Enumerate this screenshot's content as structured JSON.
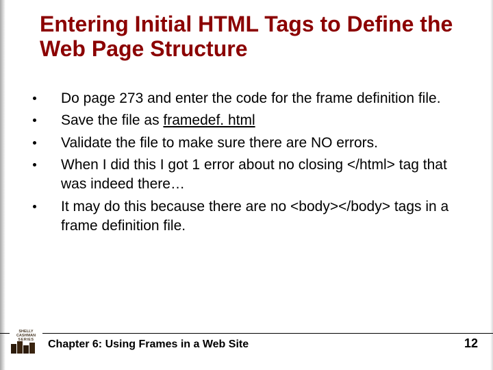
{
  "title": "Entering Initial HTML Tags to Define the Web Page Structure",
  "bullets": [
    {
      "pre": "Do page 273 and enter the code for the frame definition file.",
      "u": "",
      "post": ""
    },
    {
      "pre": "Save the file as ",
      "u": "framedef. html",
      "post": ""
    },
    {
      "pre": "Validate the file to make sure there are NO errors.",
      "u": "",
      "post": ""
    },
    {
      "pre": "When I did this I got 1 error about no closing </html> tag that was indeed there…",
      "u": "",
      "post": ""
    },
    {
      "pre": "It may do this because there are no <body></body> tags in a frame definition file.",
      "u": "",
      "post": ""
    }
  ],
  "footer": {
    "chapter": "Chapter 6: Using Frames in a Web Site",
    "page": "12"
  },
  "logo": {
    "line1": "SHELLY",
    "line2": "CASHMAN",
    "line3": "SERIES"
  }
}
